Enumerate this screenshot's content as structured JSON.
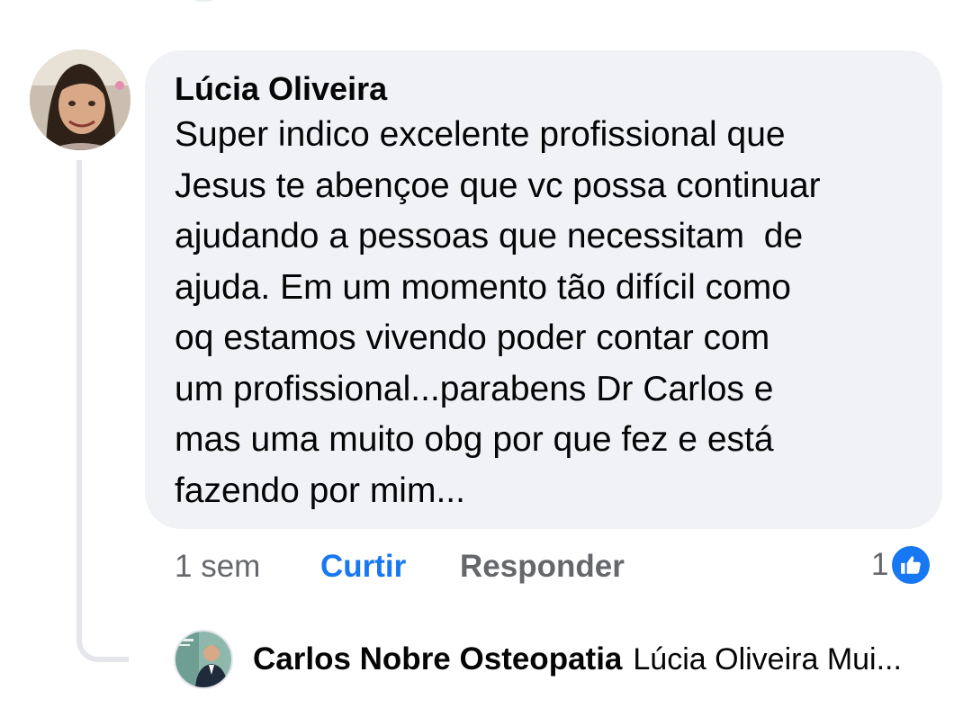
{
  "comment": {
    "author": "Lúcia Oliveira",
    "text": "Super indico excelente profissional que\nJesus te abençoe que vc possa continuar\najudando a pessoas que necessitam  de\najuda. Em um momento tão difícil como\noq estamos vivendo poder contar com\num profissional...parabens Dr Carlos e\nmas uma muito obg por que fez e está\nfazendo por mim...",
    "time": "1 sem",
    "like_label": "Curtir",
    "reply_label": "Responder",
    "reaction_count": "1",
    "reaction_icon": "thumbs-up-icon"
  },
  "reply_preview": {
    "author": "Carlos Nobre Osteopatia",
    "snippet": "Lúcia Oliveira Mui..."
  },
  "colors": {
    "accent": "#1877f2",
    "bubble_bg": "#f0f2f5",
    "secondary_text": "#65676b"
  }
}
